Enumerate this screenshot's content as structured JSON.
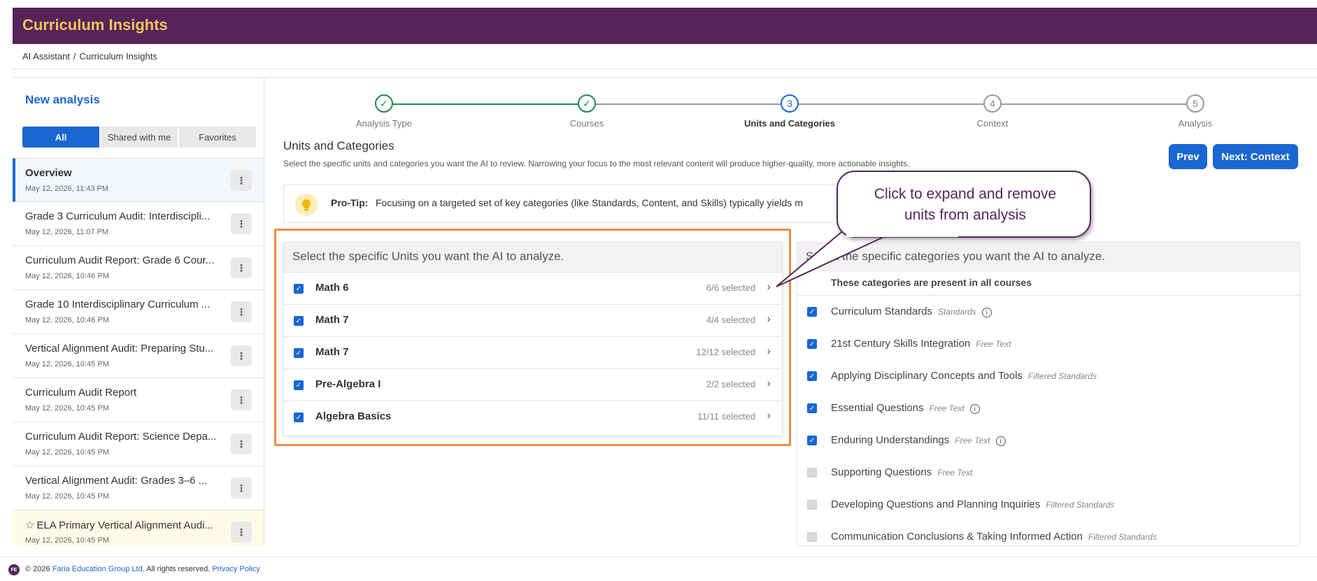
{
  "app": {
    "title": "Curriculum Insights"
  },
  "breadcrumb": {
    "items": [
      "AI Assistant",
      "Curriculum Insights"
    ]
  },
  "sidebar": {
    "new_analysis": "New analysis",
    "filters": [
      "All",
      "Shared with me",
      "Favorites"
    ],
    "items": [
      {
        "title": "Overview",
        "date": "May 12, 2026, 11:43 PM"
      },
      {
        "title": "Grade 3 Curriculum Audit: Interdiscipli...",
        "date": "May 12, 2026, 11:07 PM"
      },
      {
        "title": "Curriculum Audit Report: Grade 6 Cour...",
        "date": "May 12, 2026, 10:46 PM"
      },
      {
        "title": "Grade 10 Interdisciplinary Curriculum ...",
        "date": "May 12, 2026, 10:46 PM"
      },
      {
        "title": "Vertical Alignment Audit: Preparing Stu...",
        "date": "May 12, 2026, 10:45 PM"
      },
      {
        "title": "Curriculum Audit Report",
        "date": "May 12, 2026, 10:45 PM"
      },
      {
        "title": "Curriculum Audit Report: Science Depa...",
        "date": "May 12, 2026, 10:45 PM"
      },
      {
        "title": "Vertical Alignment Audit: Grades 3–6 ...",
        "date": "May 12, 2026, 10:45 PM"
      },
      {
        "title": "ELA Primary Vertical Alignment Audi...",
        "date": "May 12, 2026, 10:45 PM"
      }
    ],
    "kebab": "⋮"
  },
  "stepper": {
    "steps": [
      {
        "label": "Analysis Type",
        "marker": "✓",
        "state": "done"
      },
      {
        "label": "Courses",
        "marker": "✓",
        "state": "done"
      },
      {
        "label": "Units and Categories",
        "marker": "3",
        "state": "current"
      },
      {
        "label": "Context",
        "marker": "4",
        "state": "todo"
      },
      {
        "label": "Analysis",
        "marker": "5",
        "state": "todo"
      }
    ],
    "colors": {
      "done": "#1f8a4c",
      "current": "#1a66d2",
      "todo": "#9a9a9a"
    }
  },
  "section": {
    "title": "Units and Categories",
    "description": "Select the specific units and categories you want the AI to review. Narrowing your focus to the most relevant content will produce higher-quality, more actionable insights."
  },
  "buttons": {
    "prev": "Prev",
    "next": "Next: Context"
  },
  "protip": {
    "label": "Pro-Tip:",
    "text": "Focusing on a targeted set of key categories (like Standards, Content, and Skills) typically yields m"
  },
  "units_panel": {
    "heading": "Select the specific Units you want the AI to analyze.",
    "units": [
      {
        "name": "Math 6",
        "count": "6/6 selected",
        "checked": true
      },
      {
        "name": "Math 7",
        "count": "4/4 selected",
        "checked": true
      },
      {
        "name": "Math 7",
        "count": "12/12 selected",
        "checked": true
      },
      {
        "name": "Pre-Algebra I",
        "count": "2/2 selected",
        "checked": true
      },
      {
        "name": "Algebra Basics",
        "count": "11/11 selected",
        "checked": true
      }
    ]
  },
  "categories_panel": {
    "heading": "Select the specific categories you want the AI to analyze.",
    "subheading": "These categories are present in all courses",
    "categories": [
      {
        "name": "Curriculum Standards",
        "type": "Standards",
        "checked": true,
        "info": true
      },
      {
        "name": "21st Century Skills Integration",
        "type": "Free Text",
        "checked": true,
        "info": false
      },
      {
        "name": "Applying Disciplinary Concepts and Tools",
        "type": "Filtered Standards",
        "checked": true,
        "info": false
      },
      {
        "name": "Essential Questions",
        "type": "Free Text",
        "checked": true,
        "info": true
      },
      {
        "name": "Enduring Understandings",
        "type": "Free Text",
        "checked": true,
        "info": true
      },
      {
        "name": "Supporting Questions",
        "type": "Free Text",
        "checked": false,
        "info": false
      },
      {
        "name": "Developing Questions and Planning Inquiries",
        "type": "Filtered Standards",
        "checked": false,
        "info": false
      },
      {
        "name": "Communication Conclusions & Taking Informed Action",
        "type": "Filtered Standards",
        "checked": false,
        "info": false
      }
    ]
  },
  "callout": {
    "line1": "Click to expand and remove",
    "line2": "units from analysis"
  },
  "footer": {
    "logo": "FE",
    "copyright": "© 2026",
    "company": "Faria Education Group Ltd.",
    "rights": "All rights reserved.",
    "privacy": "Privacy Policy"
  },
  "icons": {
    "check": "check-icon",
    "chevron": "chevron-right-icon",
    "kebab": "more-vertical-icon",
    "bulb": "lightbulb-icon",
    "star": "star-icon",
    "info": "info-icon"
  }
}
